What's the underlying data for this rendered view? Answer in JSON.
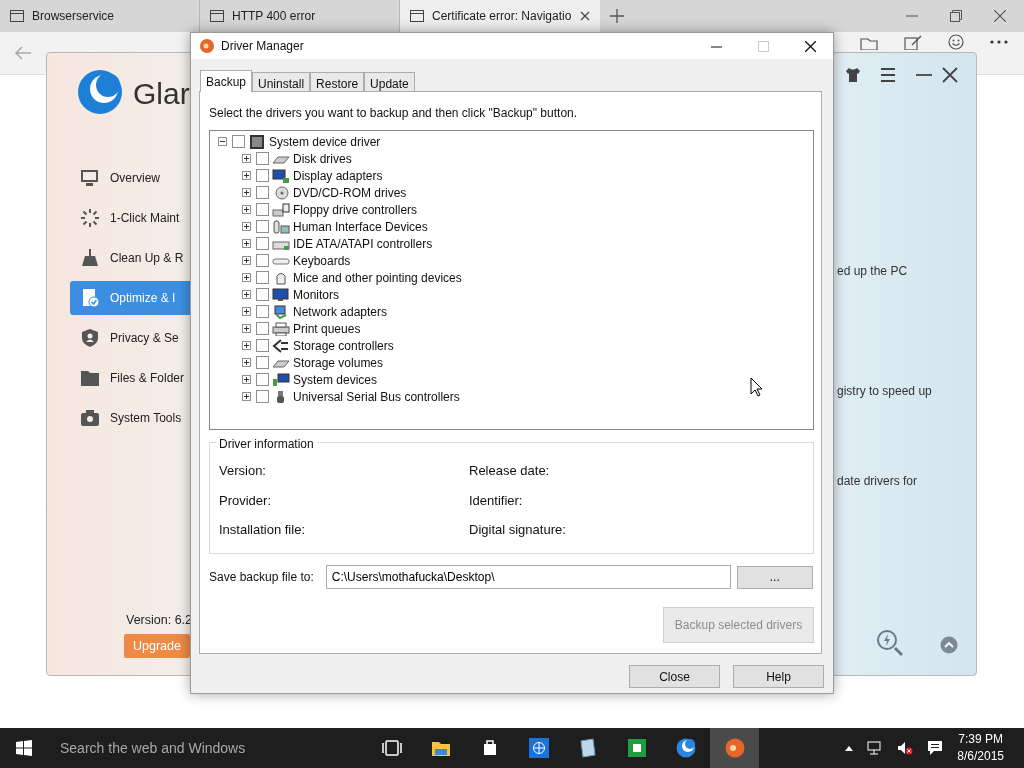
{
  "browser": {
    "tabs": [
      {
        "title": "Browserservice",
        "selected": false
      },
      {
        "title": "HTTP 400 error",
        "selected": false
      },
      {
        "title": "Certificate error: Navigatio",
        "selected": true
      }
    ]
  },
  "glary": {
    "logo_text": "Glar",
    "nav": [
      {
        "label": "Overview",
        "selected": false
      },
      {
        "label": "1-Click Maint",
        "selected": false
      },
      {
        "label": "Clean Up & R",
        "selected": false
      },
      {
        "label": "Optimize & I",
        "selected": true
      },
      {
        "label": "Privacy & Se",
        "selected": false
      },
      {
        "label": "Files & Folder",
        "selected": false
      },
      {
        "label": "System Tools",
        "selected": false
      }
    ],
    "version": "Version: 6.2",
    "upgrade": "Upgrade",
    "descriptions": [
      "ed up the PC",
      "gistry to speed up",
      "date drivers for"
    ]
  },
  "dialog": {
    "title": "Driver Manager",
    "tabs": [
      {
        "label": "Backup",
        "selected": true
      },
      {
        "label": "Uninstall",
        "selected": false
      },
      {
        "label": "Restore",
        "selected": false
      },
      {
        "label": "Update",
        "selected": false
      }
    ],
    "instruction": "Select the drivers you want to backup and then click \"Backup\" button.",
    "tree": {
      "label": "System device driver",
      "expanded": true,
      "checked": false,
      "children": [
        {
          "label": "Disk drives",
          "expanded": false,
          "checked": false
        },
        {
          "label": "Display adapters",
          "expanded": false,
          "checked": false
        },
        {
          "label": "DVD/CD-ROM drives",
          "expanded": false,
          "checked": false
        },
        {
          "label": "Floppy drive controllers",
          "expanded": false,
          "checked": false
        },
        {
          "label": "Human Interface Devices",
          "expanded": false,
          "checked": false
        },
        {
          "label": "IDE ATA/ATAPI controllers",
          "expanded": false,
          "checked": false
        },
        {
          "label": "Keyboards",
          "expanded": false,
          "checked": false
        },
        {
          "label": "Mice and other pointing devices",
          "expanded": false,
          "checked": false
        },
        {
          "label": "Monitors",
          "expanded": false,
          "checked": false
        },
        {
          "label": "Network adapters",
          "expanded": false,
          "checked": false
        },
        {
          "label": "Print queues",
          "expanded": false,
          "checked": false
        },
        {
          "label": "Storage controllers",
          "expanded": false,
          "checked": false
        },
        {
          "label": "Storage volumes",
          "expanded": false,
          "checked": false
        },
        {
          "label": "System devices",
          "expanded": false,
          "checked": false
        },
        {
          "label": "Universal Serial Bus controllers",
          "expanded": false,
          "checked": false
        }
      ]
    },
    "info": {
      "title": "Driver information",
      "fields": [
        "Version:",
        "Release date:",
        "Provider:",
        "Identifier:",
        "Installation file:",
        "Digital signature:"
      ]
    },
    "save_label": "Save backup file to:",
    "save_path": "C:\\Users\\mothafucka\\Desktop\\",
    "browse": "...",
    "backup_button": {
      "label": "Backup selected drivers",
      "disabled": true
    },
    "buttons": [
      "Close",
      "Help"
    ]
  },
  "taskbar": {
    "placeholder": "Search the web and Windows",
    "time": "7:39 PM",
    "date": "8/6/2015"
  }
}
